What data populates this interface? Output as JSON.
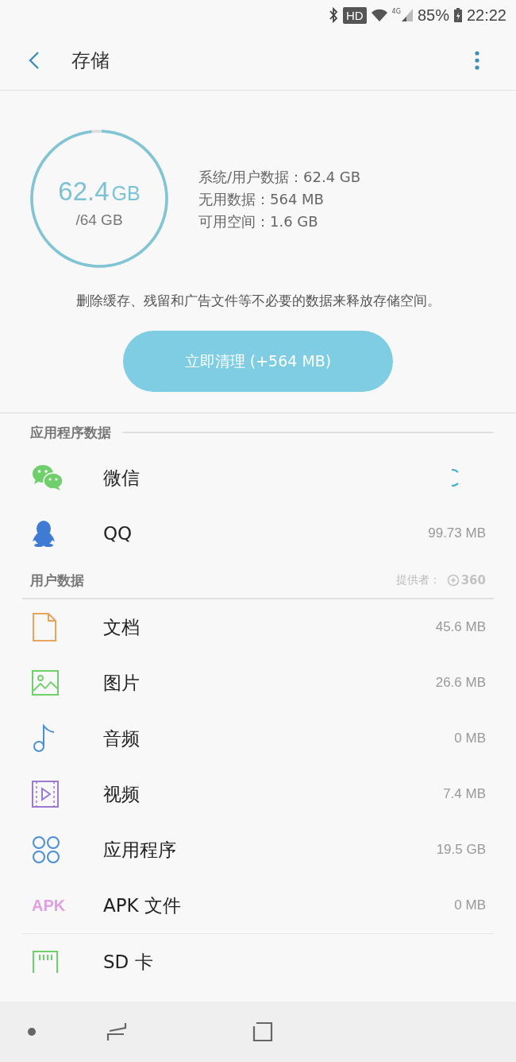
{
  "status_bar": {
    "hd": "HD",
    "network": "4G",
    "battery": "85%",
    "time": "22:22"
  },
  "header": {
    "title": "存储"
  },
  "summary": {
    "used": "62.4",
    "used_unit": "GB",
    "total": "/64 GB",
    "level": 0.975,
    "details": [
      "系统/用户数据：62.4 GB",
      "无用数据：564 MB",
      "可用空间：1.6 GB"
    ],
    "description": "删除缓存、残留和广告文件等不必要的数据来释放存储空间。",
    "clean_button": "立即清理 (+564 MB)"
  },
  "sections": [
    {
      "title": "应用程序数据",
      "items": [
        {
          "kind": "wechat",
          "label": "微信",
          "loading": true
        },
        {
          "kind": "qq",
          "label": "QQ",
          "value": "99.73 MB",
          "loading": false
        }
      ]
    },
    {
      "title": "用户数据",
      "provider": "提供者：",
      "provider_logo": "360",
      "items": [
        {
          "kind": "document",
          "label": "文档",
          "value": "45.6 MB",
          "loading": false
        },
        {
          "kind": "image",
          "label": "图片",
          "value": "26.6 MB",
          "loading": false
        },
        {
          "kind": "audio",
          "label": "音频",
          "value": "0 MB",
          "loading": false
        },
        {
          "kind": "video",
          "label": "视频",
          "value": "7.4 MB",
          "loading": false
        },
        {
          "kind": "apps",
          "label": "应用程序",
          "value": "19.5 GB",
          "loading": false
        },
        {
          "kind": "apk",
          "icon_text": "APK",
          "label": "APK 文件",
          "value": "0 MB",
          "loading": false
        },
        {
          "kind": "sdcard",
          "label": "SD 卡",
          "loading": false
        }
      ]
    }
  ]
}
